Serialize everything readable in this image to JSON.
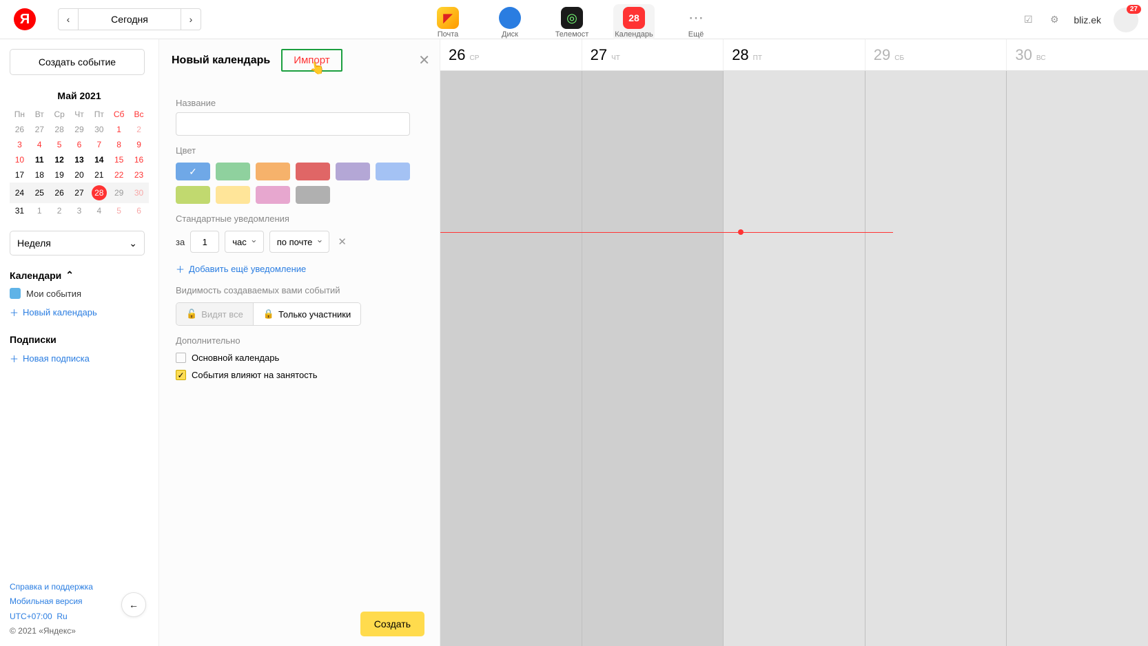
{
  "topbar": {
    "today_label": "Сегодня",
    "services": [
      {
        "name": "mail",
        "label": "Почта",
        "bg": "#ffcc00",
        "glyph": "▲"
      },
      {
        "name": "disk",
        "label": "Диск",
        "bg": "#2a7de1",
        "glyph": ""
      },
      {
        "name": "telemost",
        "label": "Телемост",
        "bg": "#222",
        "glyph": "◎"
      },
      {
        "name": "calendar",
        "label": "Календарь",
        "bg": "#ff3333",
        "glyph": "28",
        "active": true
      },
      {
        "name": "more",
        "label": "Ещё",
        "bg": "#eee",
        "glyph": "⋯"
      }
    ],
    "user": "bliz.ek",
    "badge": "27"
  },
  "sidebar": {
    "create_event": "Создать событие",
    "month": "Май 2021",
    "week_days": [
      "Пн",
      "Вт",
      "Ср",
      "Чт",
      "Пт",
      "Сб",
      "Вс"
    ],
    "rows": [
      [
        {
          "d": "26",
          "dim": true
        },
        {
          "d": "27",
          "dim": true
        },
        {
          "d": "28",
          "dim": true
        },
        {
          "d": "29",
          "dim": true
        },
        {
          "d": "30",
          "dim": true
        },
        {
          "d": "1",
          "red": true
        },
        {
          "d": "2",
          "dim": true,
          "red": true
        }
      ],
      [
        {
          "d": "3",
          "red": true
        },
        {
          "d": "4",
          "red": true
        },
        {
          "d": "5",
          "red": true
        },
        {
          "d": "6",
          "red": true
        },
        {
          "d": "7",
          "red": true
        },
        {
          "d": "8",
          "red": true
        },
        {
          "d": "9",
          "red": true
        }
      ],
      [
        {
          "d": "10",
          "red": true
        },
        {
          "d": "11",
          "bold": true
        },
        {
          "d": "12",
          "bold": true
        },
        {
          "d": "13",
          "bold": true
        },
        {
          "d": "14",
          "bold": true
        },
        {
          "d": "15",
          "red": true
        },
        {
          "d": "16",
          "red": true
        }
      ],
      [
        {
          "d": "17"
        },
        {
          "d": "18"
        },
        {
          "d": "19"
        },
        {
          "d": "20"
        },
        {
          "d": "21"
        },
        {
          "d": "22",
          "red": true
        },
        {
          "d": "23",
          "red": true
        }
      ],
      [
        {
          "d": "24"
        },
        {
          "d": "25"
        },
        {
          "d": "26"
        },
        {
          "d": "27"
        },
        {
          "d": "28",
          "today": true
        },
        {
          "d": "29",
          "dim": true
        },
        {
          "d": "30",
          "dim": true,
          "red": true
        }
      ],
      [
        {
          "d": "31"
        },
        {
          "d": "1",
          "dim": true
        },
        {
          "d": "2",
          "dim": true
        },
        {
          "d": "3",
          "dim": true
        },
        {
          "d": "4",
          "dim": true
        },
        {
          "d": "5",
          "dim": true,
          "red": true
        },
        {
          "d": "6",
          "dim": true,
          "red": true
        }
      ]
    ],
    "current_week_index": 4,
    "view_label": "Неделя",
    "cal_section": "Календари",
    "my_events": "Мои события",
    "my_events_color": "#5fb3e7",
    "new_cal": "Новый календарь",
    "subs_section": "Подписки",
    "new_sub": "Новая подписка",
    "help": "Справка и поддержка",
    "mobile": "Мобильная версия",
    "tz": "UTC+07:00",
    "lang": "Ru",
    "copyright": "© 2021 «Яндекс»"
  },
  "panel": {
    "tab_new": "Новый календарь",
    "tab_import": "Импорт",
    "label_name": "Название",
    "name_value": "",
    "label_color": "Цвет",
    "colors": [
      "#6fa8e7",
      "#8fd19e",
      "#f6b26b",
      "#e06666",
      "#b4a7d6",
      "#a4c2f4",
      "#c1d96f",
      "#ffe599",
      "#e7a7cf",
      "#b0b0b0"
    ],
    "selected_color_index": 0,
    "label_notif": "Стандартные уведомления",
    "notif_prefix": "за",
    "notif_value": "1",
    "notif_unit": "час",
    "notif_method": "по почте",
    "add_notif": "Добавить ещё уведомление",
    "label_vis": "Видимость создаваемых вами событий",
    "vis_all": "Видят все",
    "vis_participants": "Только участники",
    "label_extra": "Дополнительно",
    "chk_main": "Основной календарь",
    "chk_busy": "События влияют на занятость",
    "create": "Создать"
  },
  "grid": {
    "days": [
      {
        "num": "26",
        "abbr": "СР",
        "dim": false
      },
      {
        "num": "27",
        "abbr": "ЧТ",
        "dim": false
      },
      {
        "num": "28",
        "abbr": "ПТ",
        "dim": false,
        "today": true
      },
      {
        "num": "29",
        "abbr": "СБ",
        "dim": true
      },
      {
        "num": "30",
        "abbr": "ВС",
        "dim": true
      }
    ]
  }
}
